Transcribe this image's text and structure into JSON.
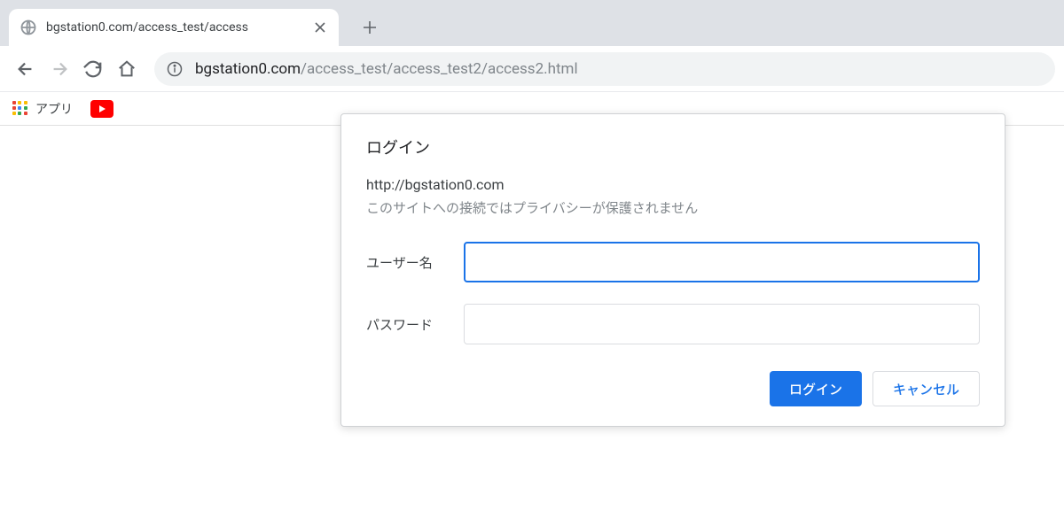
{
  "tab": {
    "title": "bgstation0.com/access_test/access"
  },
  "omnibox": {
    "domain": "bgstation0.com",
    "path": "/access_test/access_test2/access2.html"
  },
  "bookmarks": {
    "apps_label": "アプリ"
  },
  "dialog": {
    "title": "ログイン",
    "origin": "http://bgstation0.com",
    "warning": "このサイトへの接続ではプライバシーが保護されません",
    "username_label": "ユーザー名",
    "password_label": "パスワード",
    "username_value": "",
    "password_value": "",
    "login_button": "ログイン",
    "cancel_button": "キャンセル"
  }
}
